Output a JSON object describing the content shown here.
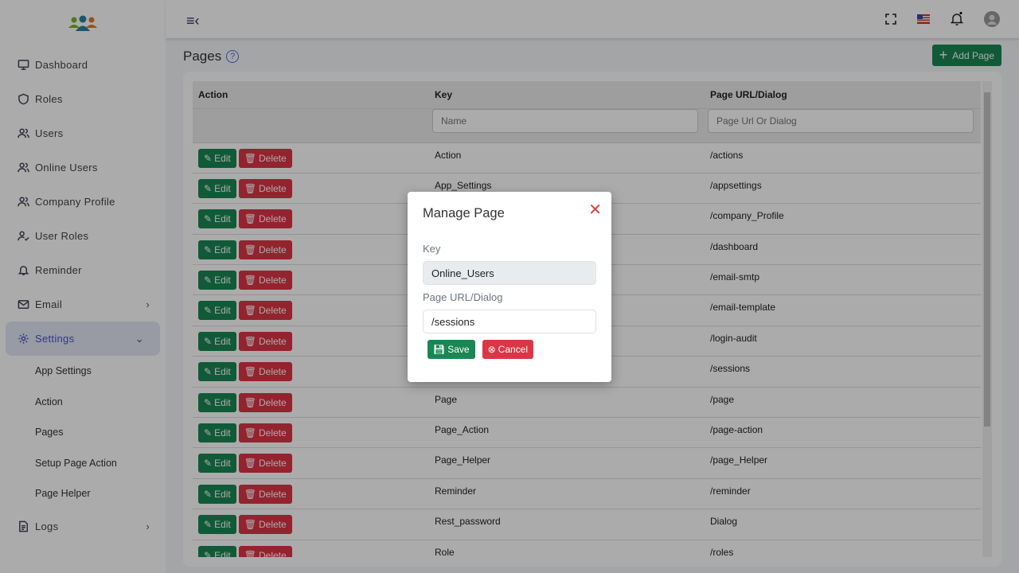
{
  "sidebar": {
    "items": [
      {
        "label": "Dashboard"
      },
      {
        "label": "Roles"
      },
      {
        "label": "Users"
      },
      {
        "label": "Online Users"
      },
      {
        "label": "Company Profile"
      },
      {
        "label": "User Roles"
      },
      {
        "label": "Reminder"
      },
      {
        "label": "Email"
      },
      {
        "label": "Settings"
      }
    ],
    "settings_sub": [
      "App Settings",
      "Action",
      "Pages",
      "Setup Page Action",
      "Page Helper"
    ],
    "logs": "Logs"
  },
  "page": {
    "title": "Pages",
    "add_label": "Add Page"
  },
  "table": {
    "headers": [
      "Action",
      "Key",
      "Page URL/Dialog"
    ],
    "placeholders": {
      "key": "Name",
      "url": "Page Url Or Dialog"
    },
    "edit_label": "Edit",
    "delete_label": "Delete",
    "rows": [
      {
        "key": "Action",
        "url": "/actions"
      },
      {
        "key": "App_Settings",
        "url": "/appsettings"
      },
      {
        "key": "",
        "url": "/company_Profile"
      },
      {
        "key": "",
        "url": "/dashboard"
      },
      {
        "key": "",
        "url": "/email-smtp"
      },
      {
        "key": "",
        "url": "/email-template"
      },
      {
        "key": "",
        "url": "/login-audit"
      },
      {
        "key": "",
        "url": "/sessions"
      },
      {
        "key": "Page",
        "url": "/page"
      },
      {
        "key": "Page_Action",
        "url": "/page-action"
      },
      {
        "key": "Page_Helper",
        "url": "/page_Helper"
      },
      {
        "key": "Reminder",
        "url": "/reminder"
      },
      {
        "key": "Rest_password",
        "url": "Dialog"
      },
      {
        "key": "Role",
        "url": "/roles"
      }
    ]
  },
  "modal": {
    "title": "Manage Page",
    "key_label": "Key",
    "key_value": "Online_Users",
    "url_label": "Page URL/Dialog",
    "url_value": "/sessions",
    "save": "Save",
    "cancel": "Cancel"
  }
}
